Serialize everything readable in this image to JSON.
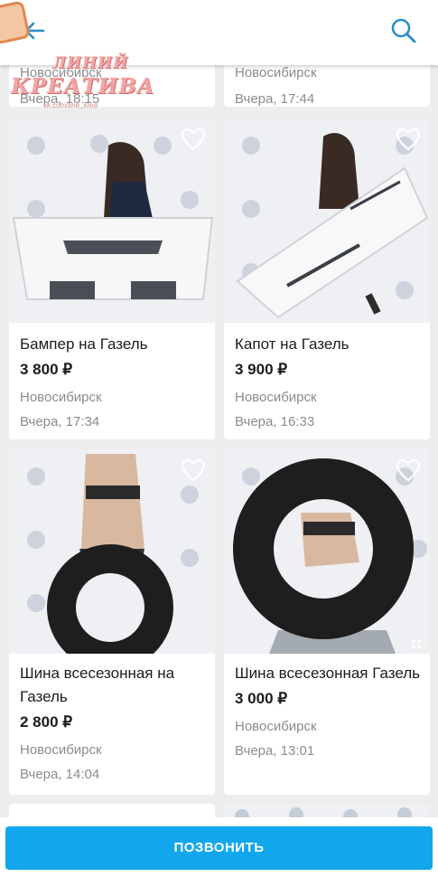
{
  "colors": {
    "accent": "#12a7ec",
    "icon": "#2a8fc4",
    "muted": "#8c8c8c"
  },
  "watermark": {
    "line1": "ЛИНИЙ",
    "line2": "КРЕАТИВА",
    "url": "vk.com/line_krea"
  },
  "header": {
    "back_icon": "arrow-left-icon",
    "search_icon": "search-icon"
  },
  "top_cards": [
    {
      "city": "Новосибирск",
      "date": "Вчера, 18:15"
    },
    {
      "city": "Новосибирск",
      "date": "Вчера, 17:44"
    }
  ],
  "listings": [
    {
      "title": "Бампер на Газель",
      "price": "3 800 ₽",
      "city": "Новосибирск",
      "date": "Вчера, 17:34"
    },
    {
      "title": "Капот на Газель",
      "price": "3 900 ₽",
      "city": "Новосибирск",
      "date": "Вчера, 16:33"
    },
    {
      "title": "Шина всесезонная на Газель",
      "price": "2 800 ₽",
      "city": "Новосибирск",
      "date": "Вчера, 14:04"
    },
    {
      "title": "Шина всесезонная Газель",
      "price": "3 000 ₽",
      "city": "Новосибирск",
      "date": "Вчера, 13:01"
    }
  ],
  "call_button": {
    "label": "ПОЗВОНИТЬ"
  }
}
